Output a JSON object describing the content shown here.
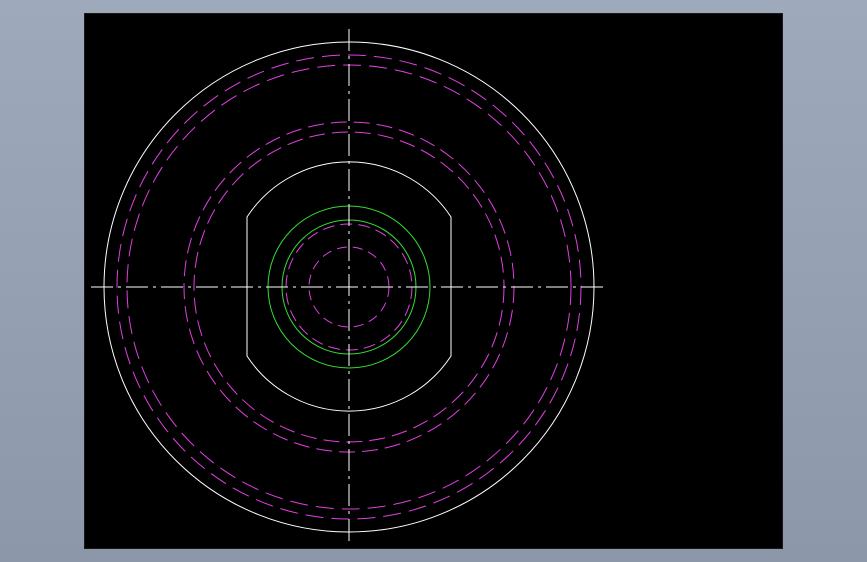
{
  "canvas": {
    "background_color": "#000000",
    "surround_color": "#9eaabb"
  },
  "drawing": {
    "colors": {
      "outline": "#ffffff",
      "hidden": "#e040e0",
      "thread": "#33dd33",
      "centerline": "#ffffff"
    },
    "views": [
      "top-view"
    ]
  }
}
